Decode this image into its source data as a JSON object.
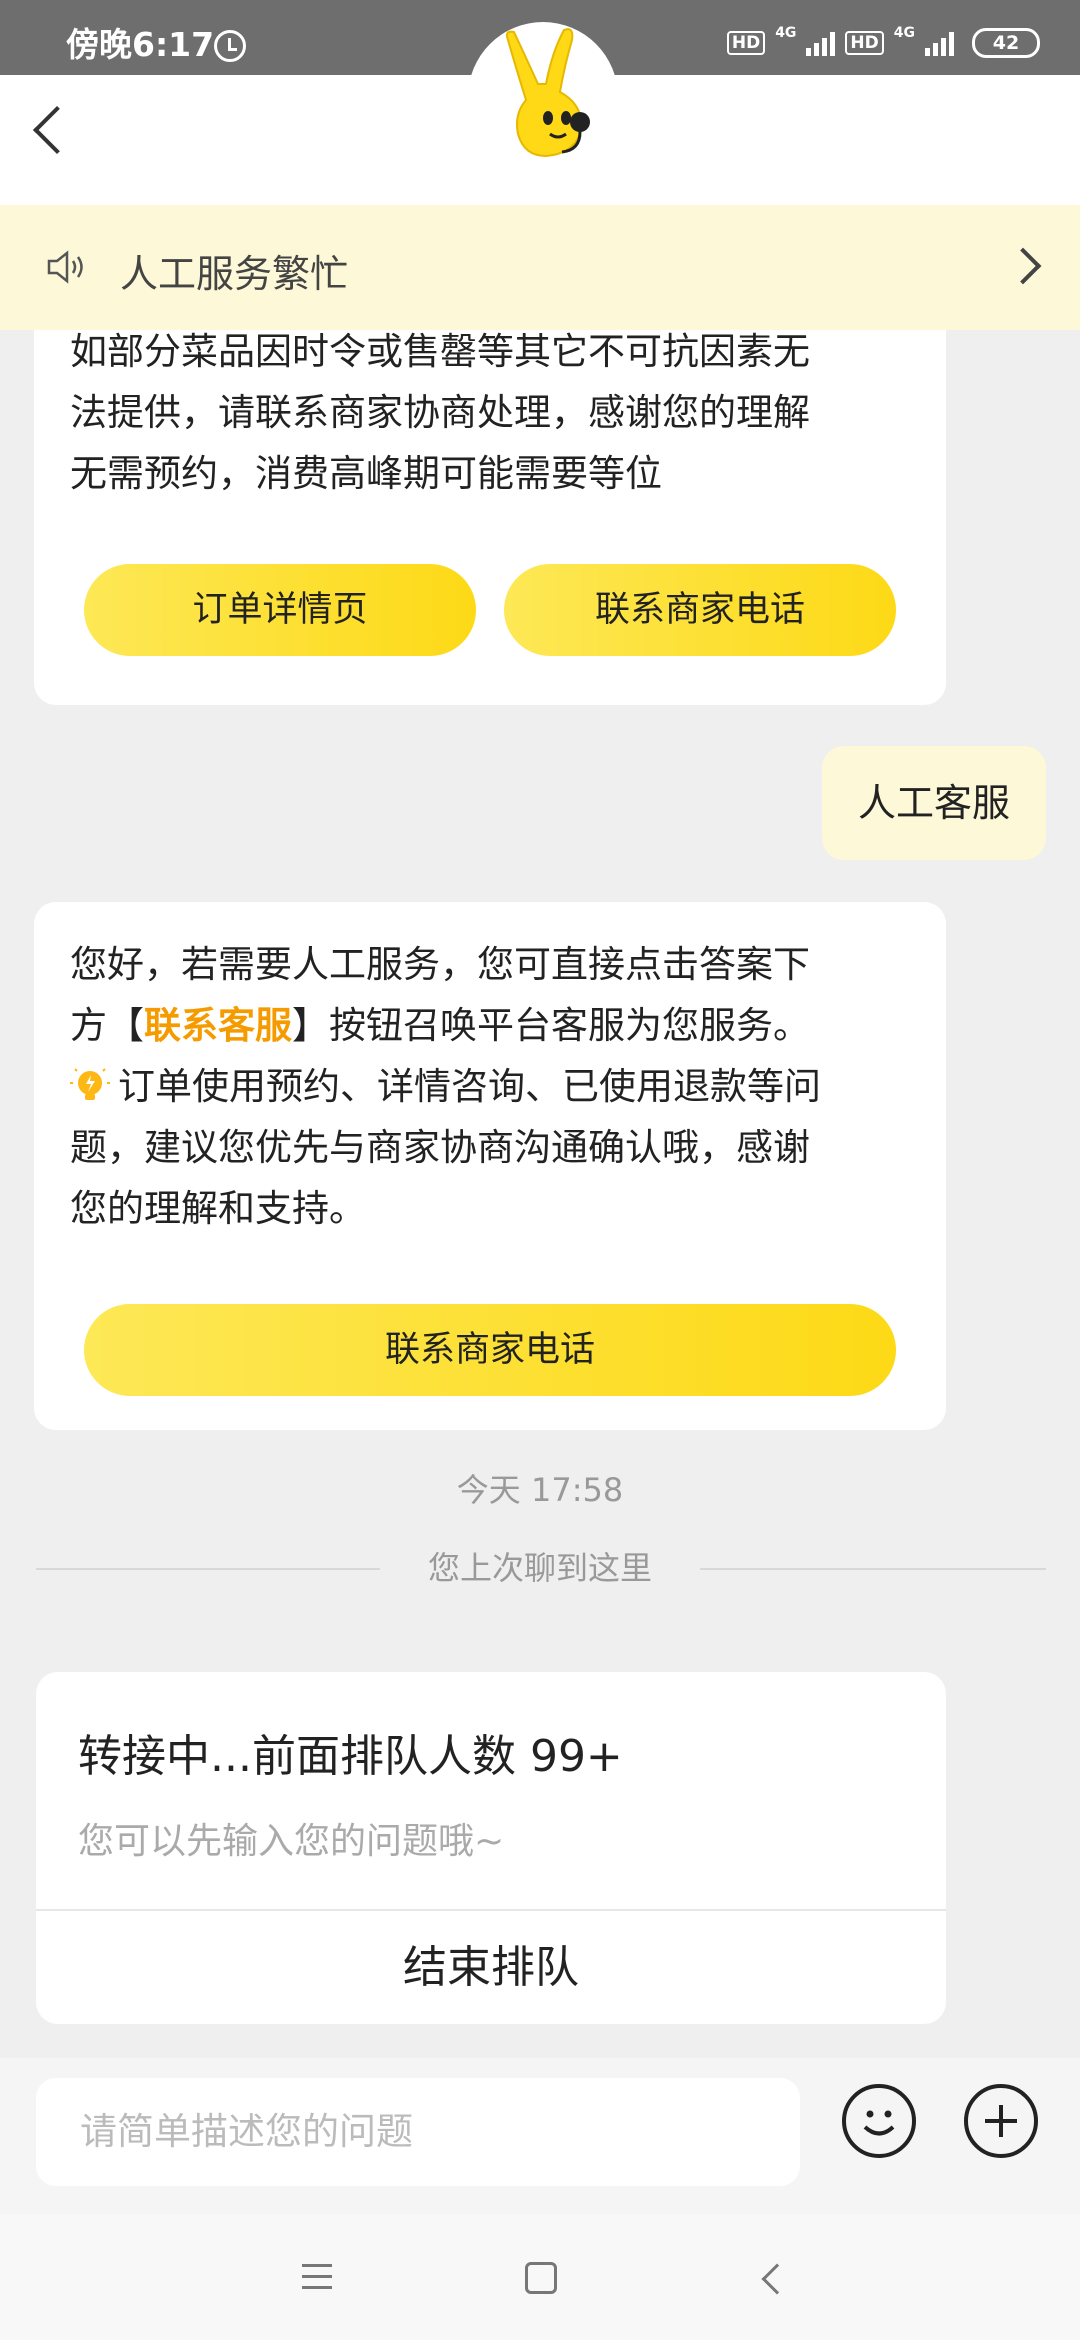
{
  "status_bar": {
    "time": "傍晚6:17",
    "hd1": "HD",
    "net1": "4G",
    "hd2": "HD",
    "net2": "4G",
    "battery": "42",
    "alarm_icon": "alarm-icon"
  },
  "header": {
    "back_icon": "back-arrow-icon",
    "mascot": "mascot-avatar"
  },
  "notice": {
    "speaker_icon": "speaker-icon",
    "text": "人工服务繁忙",
    "chevron_icon": "chevron-right-icon"
  },
  "bot_message_1": {
    "lines": [
      "如部分菜品因时令或售罄等其它不可抗因素无",
      "法提供，请联系商家协商处理，感谢您的理解",
      "无需预约，消费高峰期可能需要等位"
    ],
    "button_order_detail": "订单详情页",
    "button_call_merchant": "联系商家电话"
  },
  "user_message": {
    "text": "人工客服"
  },
  "bot_message_2": {
    "line1": "您好，若需要人工服务，您可直接点击答案下",
    "line2_pre": "方【",
    "line2_highlight": "联系客服",
    "line2_post": "】按钮召唤平台客服为您服务。",
    "tip_icon": "lightbulb-icon",
    "line3": "订单使用预约、详情咨询、已使用退款等问",
    "line4": "题，建议您优先与商家协商沟通确认哦，感谢",
    "line5": "您的理解和支持。",
    "button_call_merchant": "联系商家电话"
  },
  "timestamp": "今天 17:58",
  "last_read_divider": "您上次聊到这里",
  "queue_card": {
    "title": "转接中...前面排队人数 99+",
    "subtitle": "您可以先输入您的问题哦~",
    "end_button": "结束排队"
  },
  "input_bar": {
    "placeholder": "请简单描述您的问题",
    "emoji_icon": "emoji-icon",
    "plus_icon": "plus-icon"
  },
  "nav_bar": {
    "menu_icon": "menu-icon",
    "home_icon": "home-icon",
    "back_icon": "nav-back-icon"
  },
  "colors": {
    "accent_yellow": "#fde234",
    "highlight_orange": "#f59b00",
    "notice_bg": "#fdf8d8"
  }
}
